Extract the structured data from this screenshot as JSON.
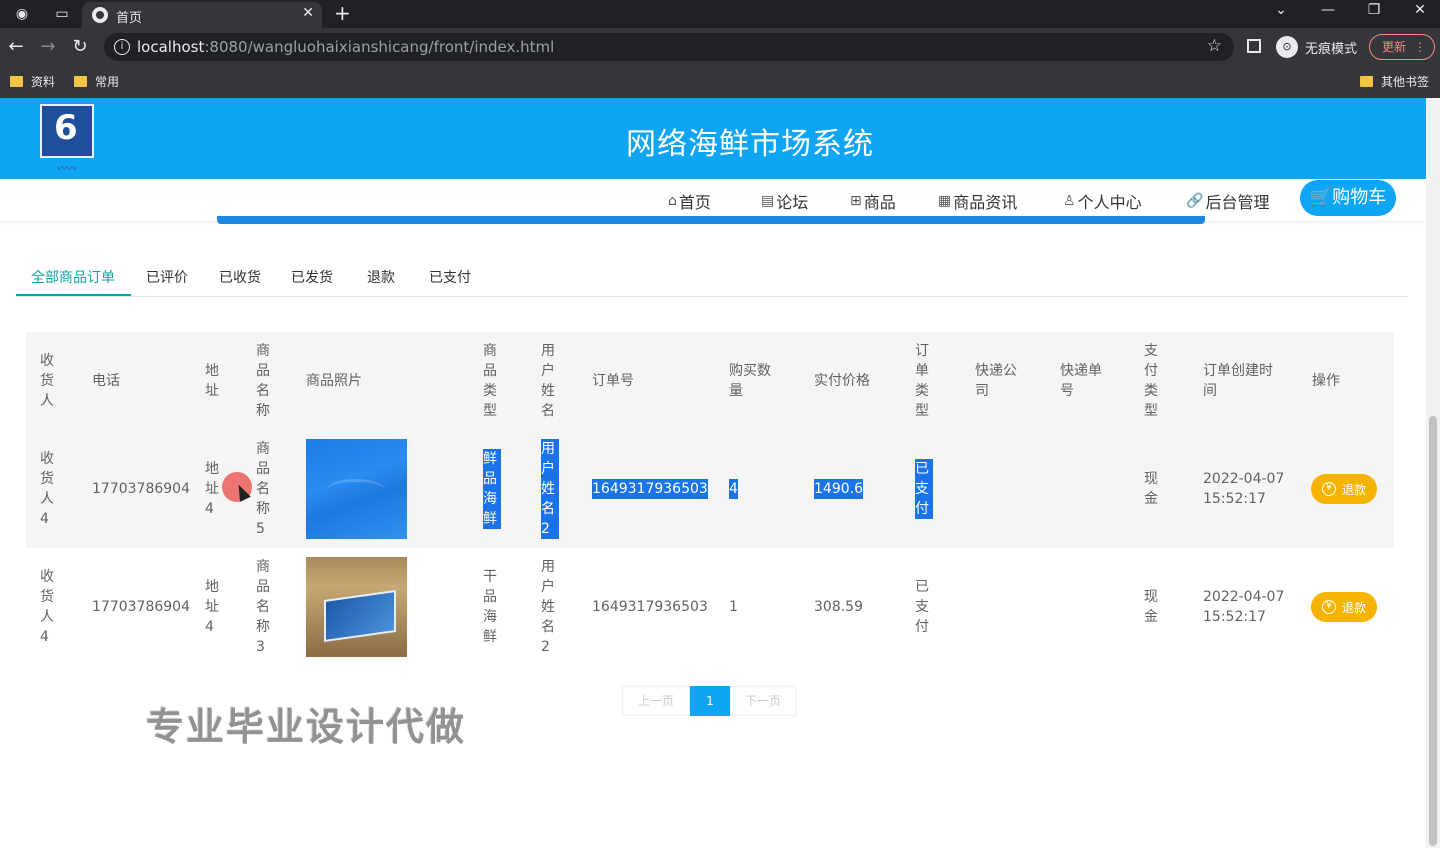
{
  "browser": {
    "tab_title": "首页",
    "url_host": "localhost",
    "url_rest": ":8080/wangluohaixianshicang/front/index.html",
    "incognito_label": "无痕模式",
    "update_label": "更新",
    "bookmarks": [
      "资料",
      "常用"
    ],
    "other_bookmarks": "其他书签"
  },
  "site": {
    "title": "网络海鲜市场系统",
    "nav": [
      "首页",
      "论坛",
      "商品",
      "商品资讯",
      "个人中心",
      "后台管理"
    ],
    "cart": "购物车"
  },
  "order_tabs": [
    "全部商品订单",
    "已评价",
    "已收货",
    "已发货",
    "退款",
    "已支付"
  ],
  "table": {
    "headers": [
      "收货人",
      "电话",
      "地址",
      "商品名称",
      "商品照片",
      "商品类型",
      "用户姓名",
      "订单号",
      "购买数量",
      "实付价格",
      "订单类型",
      "快递公司",
      "快递单号",
      "支付类型",
      "订单创建时间",
      "操作"
    ],
    "rows": [
      {
        "receiver": "收货人4",
        "phone": "17703786904",
        "address": "地址4",
        "product_name": "商品名称5",
        "product_type": "鲜品海鲜",
        "user_name": "用户姓名2",
        "order_no": "1649317936503",
        "quantity": "4",
        "price": "1490.6",
        "order_type": "已支付",
        "courier": "",
        "tracking_no": "",
        "pay_type": "现金",
        "created_date": "2022-04-07",
        "created_time": "15:52:17",
        "action": "退款"
      },
      {
        "receiver": "收货人4",
        "phone": "17703786904",
        "address": "地址4",
        "product_name": "商品名称3",
        "product_type": "干品海鲜",
        "user_name": "用户姓名2",
        "order_no": "1649317936503",
        "quantity": "1",
        "price": "308.59",
        "order_type": "已支付",
        "courier": "",
        "tracking_no": "",
        "pay_type": "现金",
        "created_date": "2022-04-07",
        "created_time": "15:52:17",
        "action": "退款"
      }
    ]
  },
  "pagination": {
    "prev": "上一页",
    "current": "1",
    "next": "下一页"
  },
  "watermark": "专业毕业设计代做"
}
